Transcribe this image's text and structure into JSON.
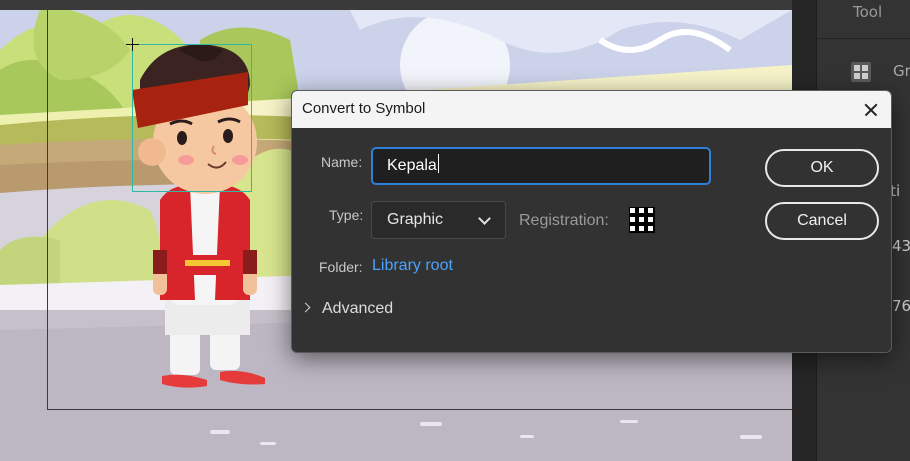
{
  "right_panel": {
    "title": "Tool",
    "group_label": "Gr",
    "frag_1": "iti",
    "frag_2": "43",
    "frag_3": "76"
  },
  "dialog": {
    "title": "Convert to Symbol",
    "name_label": "Name:",
    "name_value": "Kepala",
    "type_label": "Type:",
    "type_value": "Graphic",
    "registration_label": "Registration:",
    "folder_label": "Folder:",
    "folder_value": "Library root",
    "advanced_label": "Advanced",
    "ok_label": "OK",
    "cancel_label": "Cancel"
  },
  "colors": {
    "accent": "#2f7fd6",
    "link": "#4ba3ff",
    "selection": "#2db9a3"
  }
}
